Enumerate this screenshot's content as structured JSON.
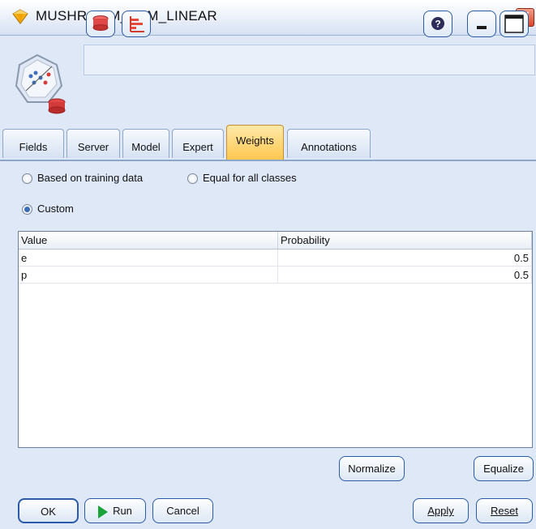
{
  "window": {
    "title": "MUSHROOM_SVM_LINEAR",
    "close_glyph": "✕"
  },
  "toolbar": {
    "icons": [
      "preview-icon",
      "chart-icon",
      "help-icon",
      "minimize-icon",
      "maximize-icon"
    ],
    "node_icon": "svm-model-node-icon"
  },
  "tabs": [
    {
      "label": "Fields",
      "active": false
    },
    {
      "label": "Server",
      "active": false
    },
    {
      "label": "Model",
      "active": false
    },
    {
      "label": "Expert",
      "active": false
    },
    {
      "label": "Weights",
      "active": true
    },
    {
      "label": "Annotations",
      "active": false
    }
  ],
  "weights": {
    "options": {
      "based_on_training": "Based on training data",
      "equal_for_all": "Equal for all classes",
      "custom": "Custom"
    },
    "selected": "custom",
    "columns": [
      "Value",
      "Probability"
    ],
    "rows": [
      {
        "value": "e",
        "probability": "0.5"
      },
      {
        "value": "p",
        "probability": "0.5"
      }
    ],
    "normalize_label": "Normalize",
    "equalize_label": "Equalize"
  },
  "footer": {
    "ok_label": "OK",
    "run_label": "Run",
    "cancel_label": "Cancel",
    "apply_label": "Apply",
    "reset_label": "Reset"
  },
  "colors": {
    "background": "#dfe8f6",
    "active_tab": "#ffc64e",
    "button_border": "#2a5aa8",
    "run_arrow": "#1aa33b",
    "close_button": "#d7452a"
  }
}
